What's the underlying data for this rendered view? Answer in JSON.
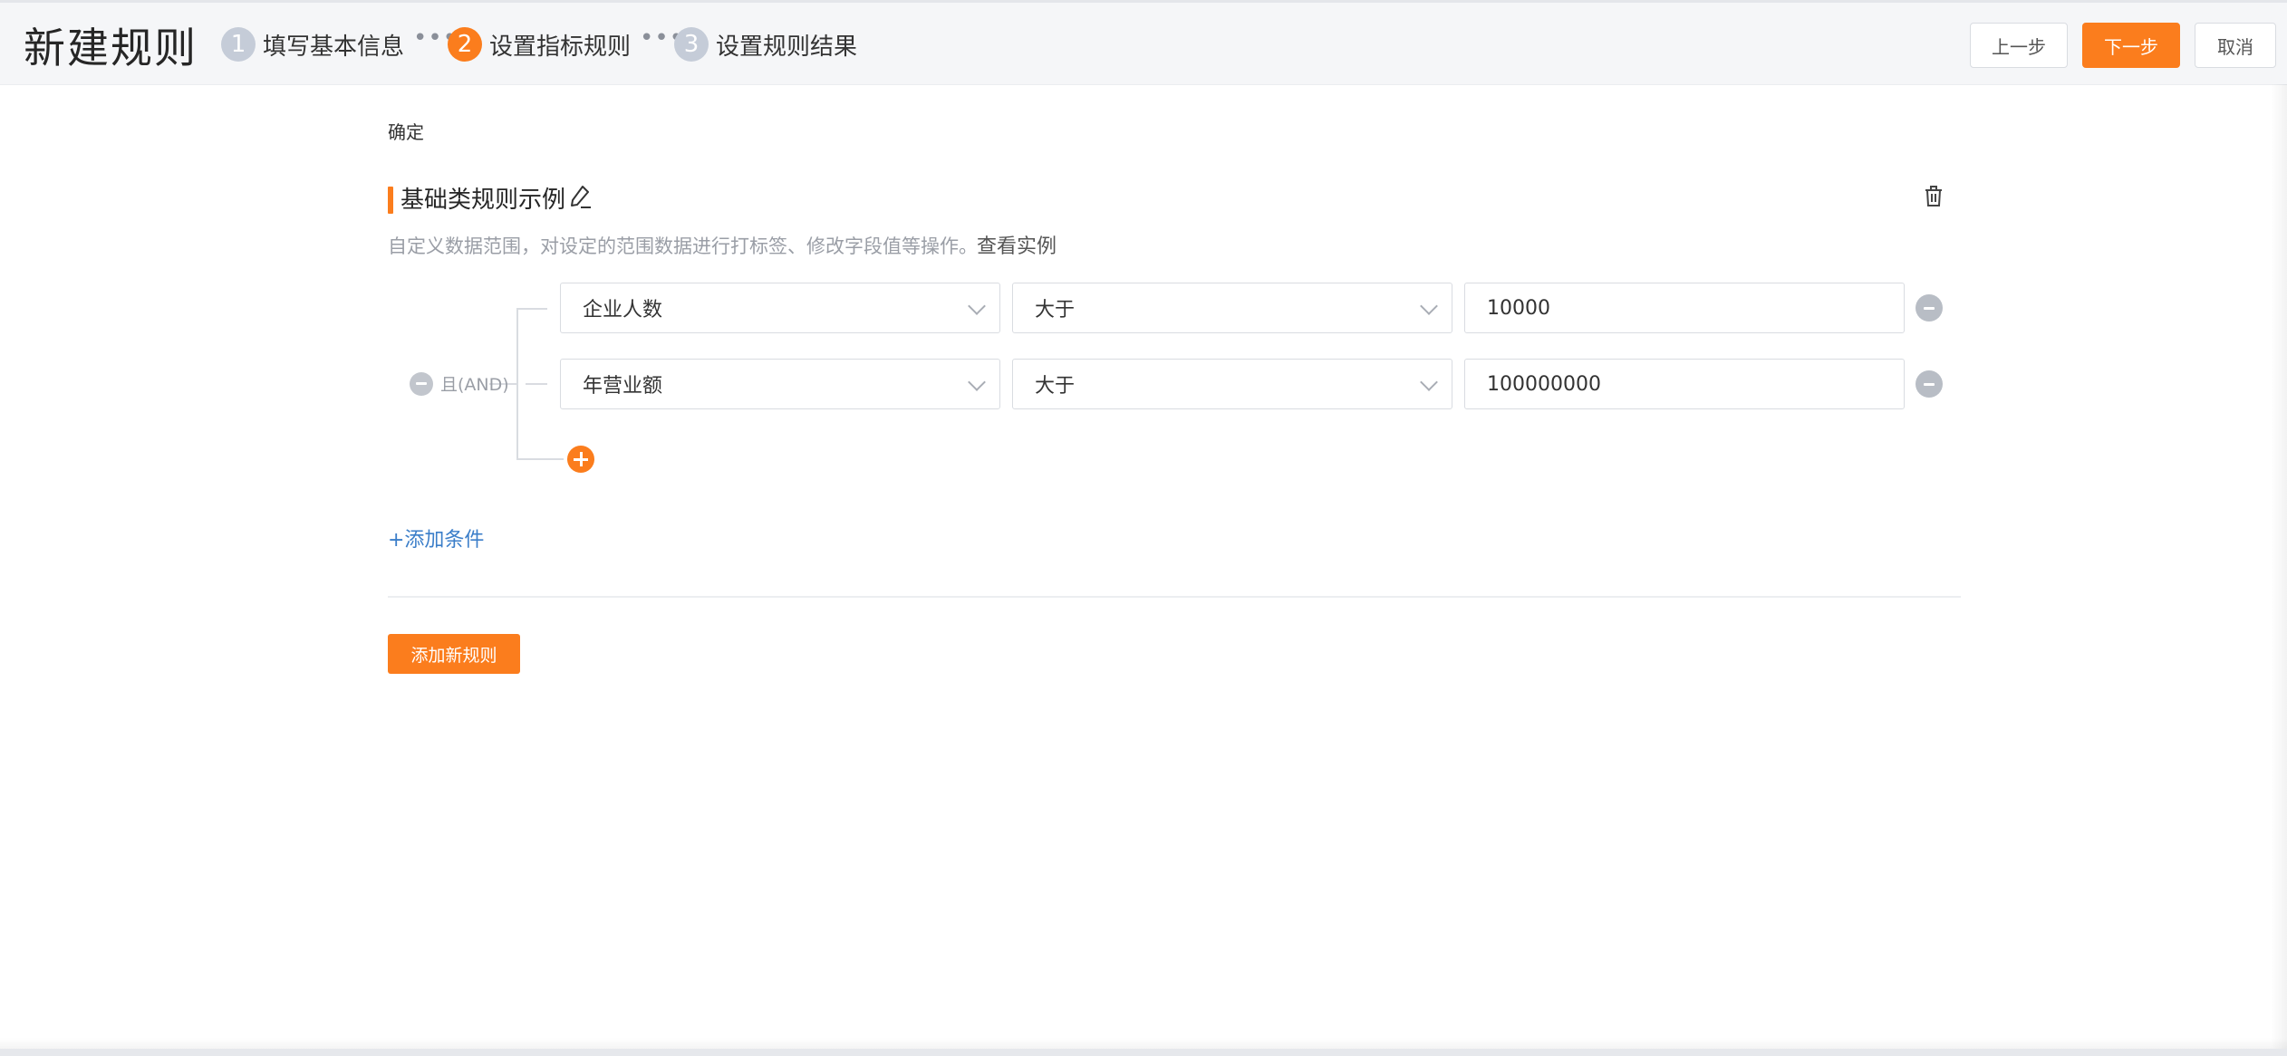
{
  "header": {
    "title": "新建规则",
    "steps": [
      {
        "num": "1",
        "label": "填写基本信息"
      },
      {
        "num": "2",
        "label": "设置指标规则"
      },
      {
        "num": "3",
        "label": "设置规则结果"
      }
    ],
    "separator": "•••",
    "prev_label": "上一步",
    "next_label": "下一步",
    "cancel_label": "取消"
  },
  "confirm_label": "确定",
  "rule": {
    "title": "基础类规则示例",
    "description": "自定义数据范围，对设定的范围数据进行打标签、修改字段值等操作。",
    "view_example": "查看实例",
    "logic_label": "且(AND)",
    "conditions": [
      {
        "field": "企业人数",
        "operator": "大于",
        "value": "10000"
      },
      {
        "field": "年营业额",
        "operator": "大于",
        "value": "100000000"
      }
    ],
    "add_condition_label": "+添加条件"
  },
  "add_rule_label": "添加新规则",
  "icons": {
    "edit": "pencil-icon",
    "delete": "trash-icon",
    "remove": "minus-circle-icon",
    "add": "plus-circle-icon",
    "dropdown": "chevron-down-icon"
  },
  "colors": {
    "accent": "#fb7d1d",
    "link": "#3b7ec9",
    "step_inactive": "#c5ccd8",
    "muted_text": "#9a9ea6"
  }
}
